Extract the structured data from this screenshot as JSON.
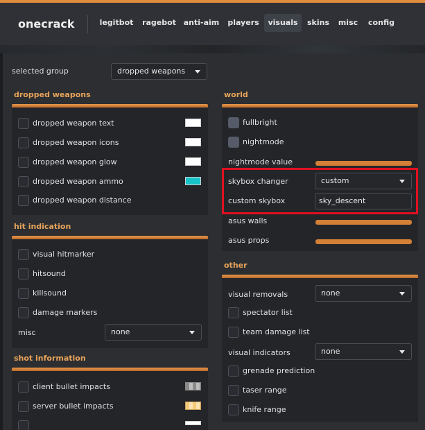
{
  "app": {
    "brand": "onecrack"
  },
  "tabs": [
    {
      "label": "legitbot"
    },
    {
      "label": "ragebot"
    },
    {
      "label": "anti-aim"
    },
    {
      "label": "players"
    },
    {
      "label": "visuals"
    },
    {
      "label": "skins"
    },
    {
      "label": "misc"
    },
    {
      "label": "config"
    }
  ],
  "selected_group": {
    "label": "selected group",
    "value": "dropped weapons"
  },
  "dropped_weapons": {
    "title": "dropped weapons",
    "items": [
      {
        "label": "dropped weapon text",
        "color": "#ffffff"
      },
      {
        "label": "dropped weapon icons",
        "color": "#ffffff"
      },
      {
        "label": "dropped weapon glow",
        "color": "#ffffff"
      },
      {
        "label": "dropped weapon ammo",
        "color": "#17c3c9"
      },
      {
        "label": "dropped weapon distance"
      }
    ]
  },
  "hit_indication": {
    "title": "hit indication",
    "items": [
      {
        "label": "visual hitmarker"
      },
      {
        "label": "hitsound"
      },
      {
        "label": "killsound"
      },
      {
        "label": "damage markers"
      }
    ],
    "misc_label": "misc",
    "misc_value": "none"
  },
  "shot_information": {
    "title": "shot information",
    "items": [
      {
        "label": "client bullet impacts"
      },
      {
        "label": "server bullet impacts"
      }
    ]
  },
  "world": {
    "title": "world",
    "fullbright": "fullbright",
    "nightmode": "nightmode",
    "nightmode_value": "nightmode value",
    "skybox_changer": {
      "label": "skybox changer",
      "value": "custom"
    },
    "custom_skybox": {
      "label": "custom skybox",
      "value": "sky_descent"
    },
    "asus_walls": "asus walls",
    "asus_props": "asus props"
  },
  "other": {
    "title": "other",
    "visual_removals": {
      "label": "visual removals",
      "value": "none"
    },
    "spectator_list": "spectator list",
    "team_damage_list": "team damage list",
    "visual_indicators": {
      "label": "visual indicators",
      "value": "none"
    },
    "grenade_prediction": "grenade prediction",
    "taser_range": "taser range",
    "knife_range": "knife range"
  },
  "colors": {
    "accent": "#e08c3c",
    "highlight": "#e01020"
  }
}
